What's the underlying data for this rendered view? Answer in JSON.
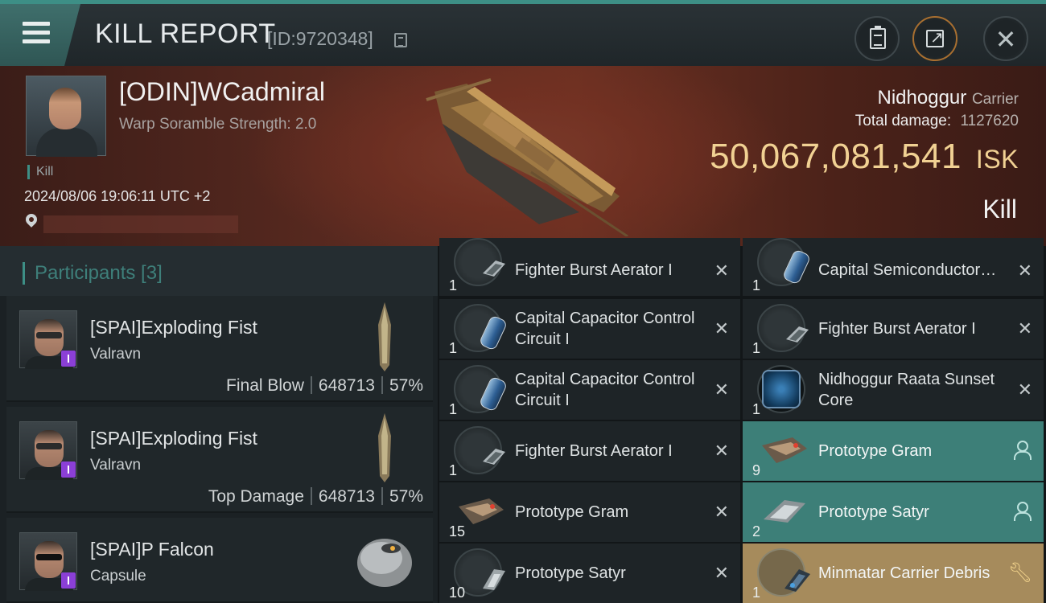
{
  "header": {
    "title": "KILL REPORT",
    "report_id": "[ID:9720348]",
    "colors": {
      "accent_teal": "#3d8f86",
      "isk_gold": "#f1d193"
    }
  },
  "victim": {
    "name": "[ODIN]WCadmiral",
    "scramble": "Warp Soramble Strength: 2.0",
    "tag": "Kill",
    "datetime": "2024/08/06 19:06:11 UTC +2",
    "ship_name": "Nidhoggur",
    "ship_class": "Carrier",
    "total_damage_label": "Total damage:",
    "total_damage": "1127620",
    "isk_value": "50,067,081,541",
    "isk_unit": "ISK",
    "result": "Kill"
  },
  "participants": {
    "title": "Participants [3]",
    "rows": [
      {
        "name": "[SPAI]Exploding Fist",
        "ship": "Valravn",
        "role": "Final Blow",
        "damage": "648713",
        "percent": "57%"
      },
      {
        "name": "[SPAI]Exploding Fist",
        "ship": "Valravn",
        "role": "Top Damage",
        "damage": "648713",
        "percent": "57%"
      },
      {
        "name": "[SPAI]P Falcon",
        "ship": "Capsule"
      }
    ]
  },
  "items": [
    {
      "qty": "1",
      "name": "Fighter Burst Aerator I",
      "icon": "fighter-burst-aerator-icon",
      "status": "destroyed"
    },
    {
      "qty": "1",
      "name": "Capital Semiconductor…",
      "icon": "capital-semiconductor-icon",
      "status": "destroyed"
    },
    {
      "qty": "1",
      "name": "Capital Capacitor Control Circuit I",
      "icon": "capacitor-circuit-icon",
      "status": "destroyed"
    },
    {
      "qty": "1",
      "name": "Fighter Burst Aerator I",
      "icon": "fighter-burst-aerator-icon",
      "status": "destroyed"
    },
    {
      "qty": "1",
      "name": "Capital Capacitor Control Circuit I",
      "icon": "capacitor-circuit-icon",
      "status": "destroyed"
    },
    {
      "qty": "1",
      "name": "Nidhoggur Raata Sunset Core",
      "icon": "sunset-core-icon",
      "status": "destroyed"
    },
    {
      "qty": "1",
      "name": "Fighter Burst Aerator I",
      "icon": "fighter-burst-aerator-icon",
      "status": "destroyed"
    },
    {
      "qty": "9",
      "name": "Prototype Gram",
      "icon": "fighter-drone-icon",
      "status": "dropped"
    },
    {
      "qty": "15",
      "name": "Prototype Gram",
      "icon": "fighter-drone-icon",
      "status": "destroyed"
    },
    {
      "qty": "2",
      "name": "Prototype Satyr",
      "icon": "fighter-drone-icon",
      "status": "dropped"
    },
    {
      "qty": "10",
      "name": "Prototype Satyr",
      "icon": "fighter-drone-icon",
      "status": "destroyed"
    },
    {
      "qty": "1",
      "name": "Minmatar Carrier Debris",
      "icon": "carrier-debris-icon",
      "status": "salvage"
    }
  ]
}
